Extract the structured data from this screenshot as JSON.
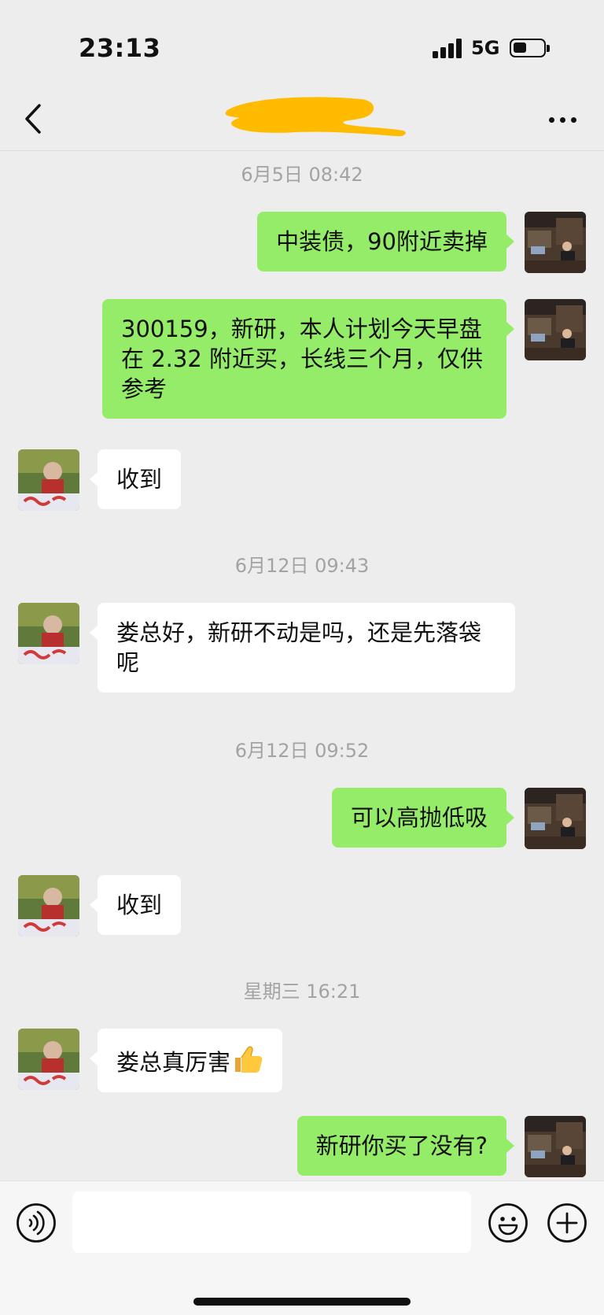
{
  "status_bar": {
    "time": "23:13",
    "network": "5G"
  },
  "nav": {
    "title": "",
    "icons": {
      "back": "chevron-left-icon",
      "more": "more-dots-icon"
    }
  },
  "colors": {
    "background": "#ededed",
    "outgoing_bubble": "#95ec69",
    "incoming_bubble": "#ffffff",
    "timestamp": "#a3a3a3",
    "redaction": "#ffbb00"
  },
  "messages": [
    {
      "type": "timestamp",
      "text": "6月5日 08:42"
    },
    {
      "type": "outgoing",
      "text": "中装债，90附近卖掉"
    },
    {
      "type": "outgoing",
      "text": "300159，新研，本人计划今天早盘在 2.32 附近买，长线三个月，仅供参考"
    },
    {
      "type": "incoming",
      "text": "收到"
    },
    {
      "type": "timestamp",
      "text": "6月12日 09:43"
    },
    {
      "type": "incoming",
      "text": "娄总好，新研不动是吗，还是先落袋呢"
    },
    {
      "type": "timestamp",
      "text": "6月12日 09:52"
    },
    {
      "type": "outgoing",
      "text": "可以高抛低吸"
    },
    {
      "type": "incoming",
      "text": "收到"
    },
    {
      "type": "timestamp",
      "text": "星期三 16:21"
    },
    {
      "type": "incoming",
      "text": "娄总真厉害",
      "emoji": "thumbs-up-icon"
    },
    {
      "type": "outgoing",
      "text": "新研你买了没有?"
    }
  ],
  "input_bar": {
    "value": "",
    "icons": {
      "voice": "voice-icon",
      "emoji": "emoji-icon",
      "plus": "plus-icon"
    }
  }
}
